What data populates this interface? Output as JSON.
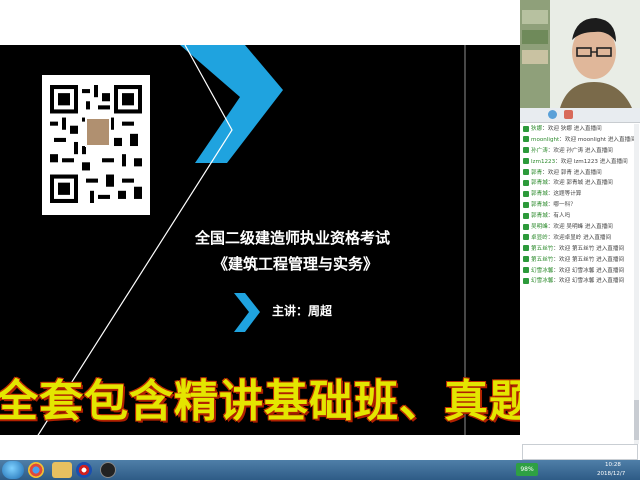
{
  "slide": {
    "title": "全国二级建造师执业资格考试",
    "subtitle": "《建筑工程管理与实务》",
    "lecturer": "主讲：周超"
  },
  "banner": {
    "text": "全套包含精讲基础班、真题班、"
  },
  "chat": {
    "messages": [
      {
        "user": "狄娜",
        "text": "欢迎 狄娜 进入直播间"
      },
      {
        "user": "moonlight",
        "text": "欢迎 moonlight 进入直播间"
      },
      {
        "user": "孙广涛",
        "text": "欢迎 孙广涛 进入直播间"
      },
      {
        "user": "lzm1223",
        "text": "欢迎 lzm1223 进入直播间"
      },
      {
        "user": "郭青",
        "text": "欢迎 郭青 进入直播间"
      },
      {
        "user": "郭青城",
        "text": "欢迎 郭青城 进入直播间"
      },
      {
        "user": "郭青城",
        "text": "这题等计算"
      },
      {
        "user": "郭青城",
        "text": "哪一科？"
      },
      {
        "user": "郭青城",
        "text": "有人吗"
      },
      {
        "user": "吴明峰",
        "text": "欢迎 吴明峰 进入直播间"
      },
      {
        "user": "卓显岭",
        "text": "欢迎卓显岭 进入直播间"
      },
      {
        "user": "第五丝竹",
        "text": "欢迎 第五丝竹 进入直播间"
      },
      {
        "user": "第五丝竹",
        "text": "欢迎 第五丝竹 进入直播间"
      },
      {
        "user": "幻雪冰馨",
        "text": "欢迎 幻雪冰馨 进入直播间"
      },
      {
        "user": "幻雪冰馨",
        "text": "欢迎 幻雪冰馨 进入直播间"
      }
    ]
  },
  "taskbar": {
    "battery": "98%",
    "time": "10:28",
    "date": "2018/12/7"
  },
  "colors": {
    "slide_bg": "#000000",
    "chevron": "#1fa3df",
    "banner_fill": "#e4e600",
    "banner_outline": "#c03000",
    "chat_user": "#2c8a2c"
  }
}
